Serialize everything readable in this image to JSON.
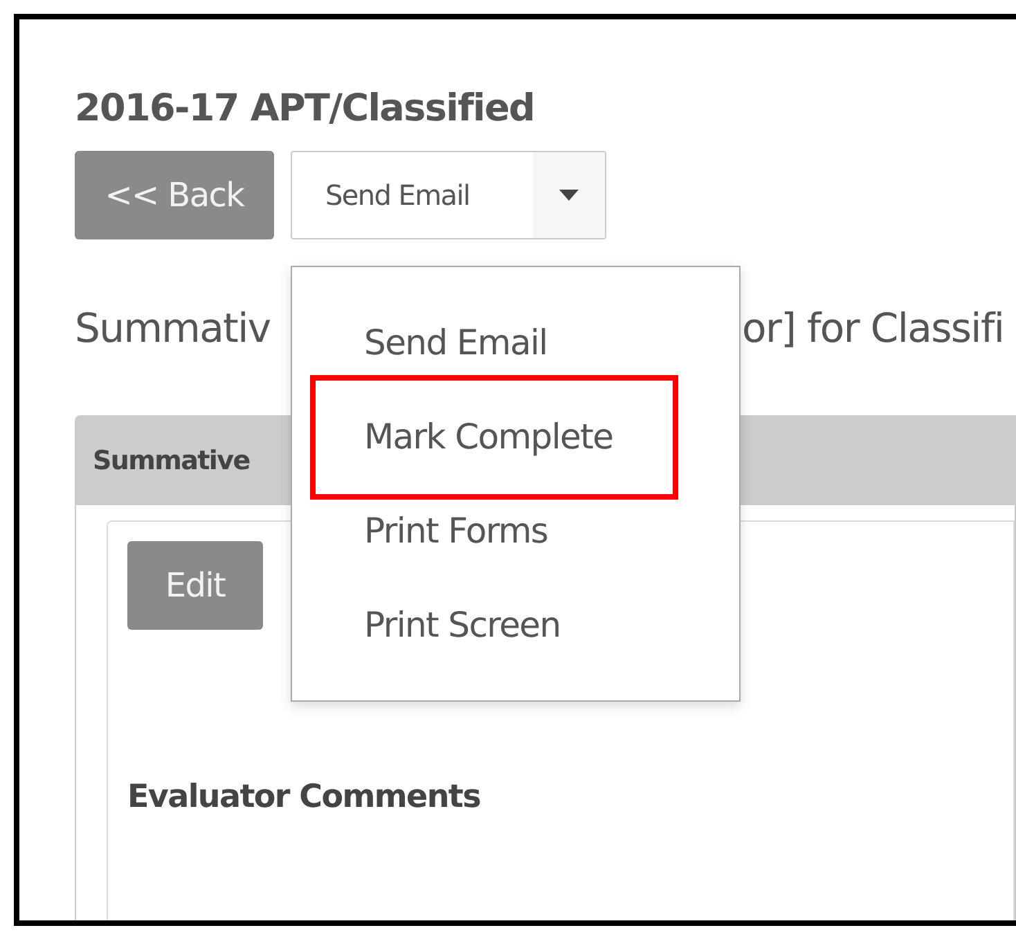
{
  "page_title": "2016-17 APT/Classified",
  "back_button": "<< Back",
  "split_button": {
    "label": "Send Email",
    "expanded": true
  },
  "subtitle": {
    "visible_start": "Summativ",
    "visible_end": "or] for Classifi"
  },
  "menu": [
    {
      "label": "Send Email",
      "highlighted": false
    },
    {
      "label": "Mark Complete",
      "highlighted": true
    },
    {
      "label": "Print Forms",
      "highlighted": false
    },
    {
      "label": "Print Screen",
      "highlighted": false
    }
  ],
  "panel": {
    "header": "Summative",
    "edit_button": "Edit",
    "section_title": "Evaluator Comments"
  }
}
